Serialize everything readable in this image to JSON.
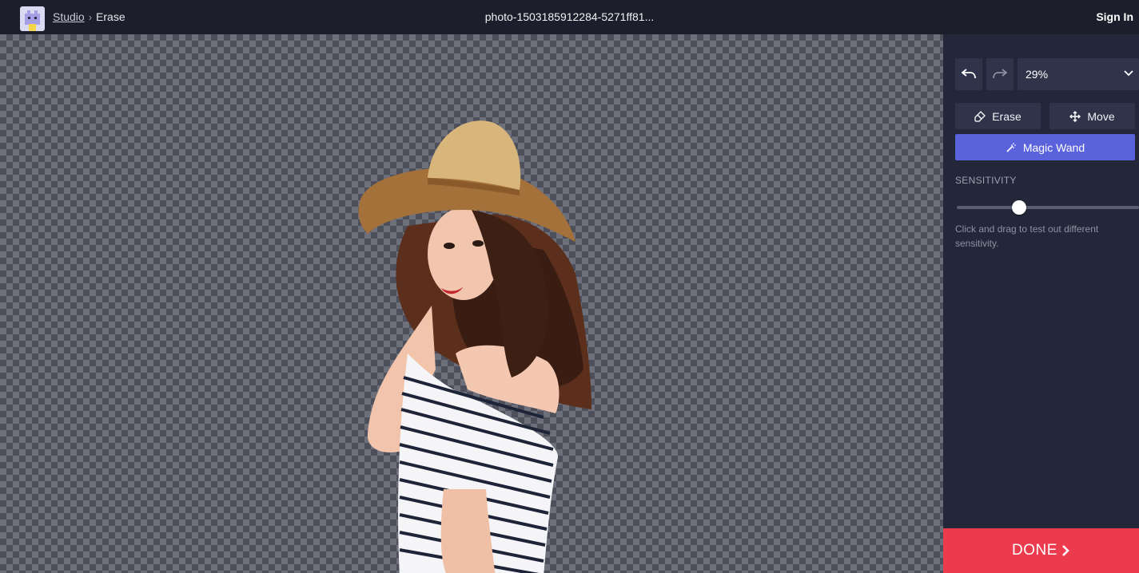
{
  "breadcrumb": {
    "root": "Studio",
    "separator": "›",
    "current": "Erase"
  },
  "file": {
    "name": "photo-1503185912284-5271ff81..."
  },
  "header": {
    "sign_in": "Sign In"
  },
  "toolbar": {
    "undo_icon": "undo-icon",
    "redo_icon": "redo-icon",
    "zoom_value": "29%",
    "erase_label": "Erase",
    "move_label": "Move",
    "magic_wand_label": "Magic Wand"
  },
  "sensitivity": {
    "label": "SENSITIVITY",
    "value": 0.31,
    "hint": "Click and drag to test out different sensitivity."
  },
  "done": {
    "label": "DONE"
  },
  "colors": {
    "accent": "#5a63dc",
    "done": "#ec3b4d",
    "panel": "#24273a",
    "topbar": "#1c1f2b"
  }
}
